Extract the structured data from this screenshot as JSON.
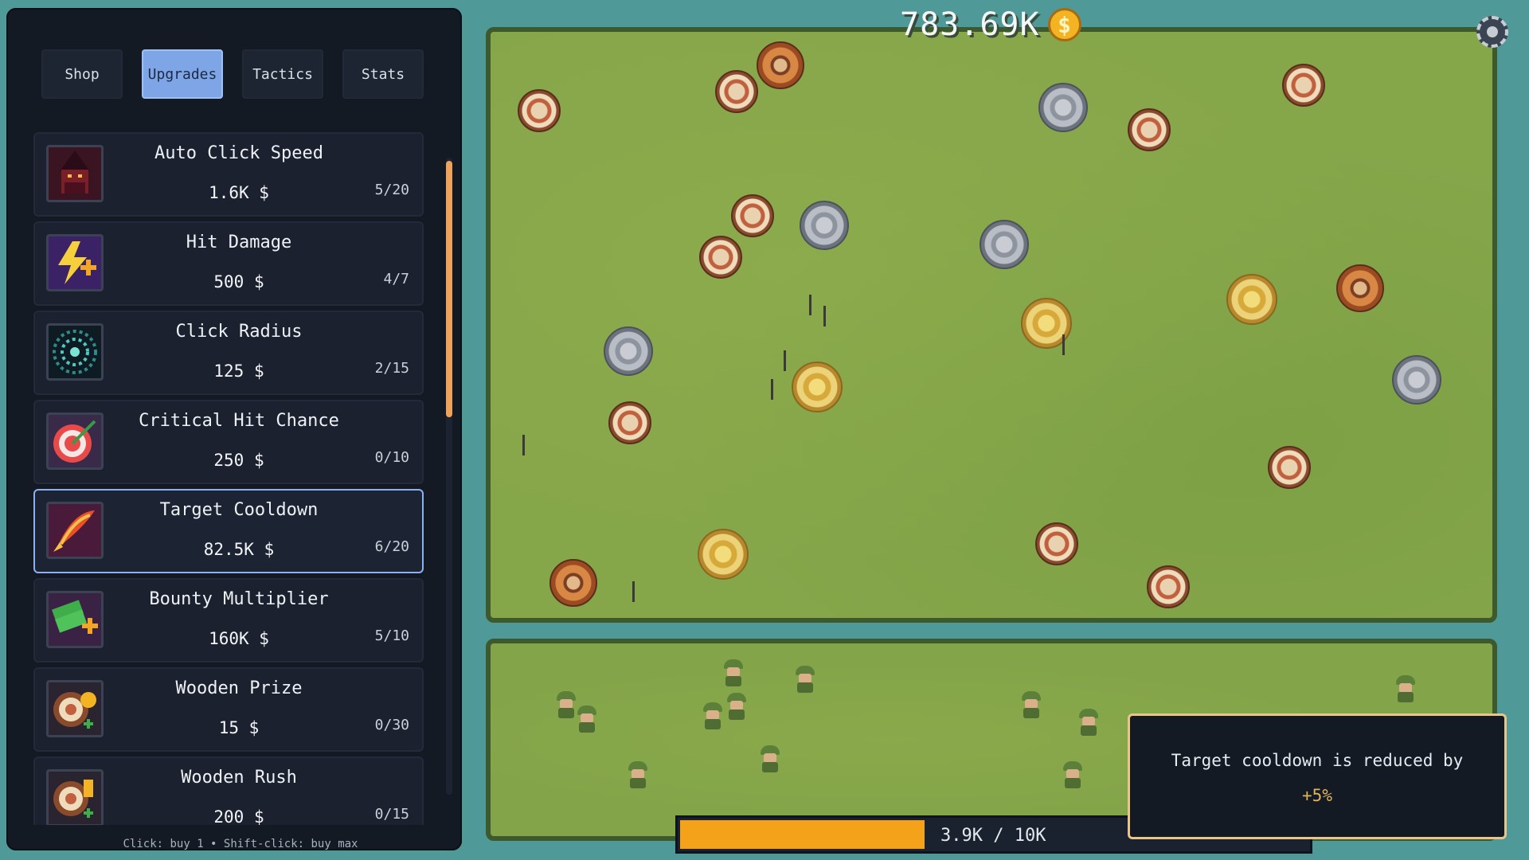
{
  "tabs": [
    {
      "label": "Shop",
      "active": false
    },
    {
      "label": "Upgrades",
      "active": true
    },
    {
      "label": "Tactics",
      "active": false
    },
    {
      "label": "Stats",
      "active": false
    }
  ],
  "upgrades": [
    {
      "name": "Auto Click Speed",
      "price": "1.6K $",
      "level": "5/20",
      "icon": "dark-wizard-icon"
    },
    {
      "name": "Hit Damage",
      "price": "500 $",
      "level": "4/7",
      "icon": "lightning-plus-icon"
    },
    {
      "name": "Click Radius",
      "price": "125 $",
      "level": "2/15",
      "icon": "radius-grid-icon"
    },
    {
      "name": "Critical Hit Chance",
      "price": "250 $",
      "level": "0/10",
      "icon": "bullseye-arrow-icon"
    },
    {
      "name": "Target Cooldown",
      "price": "82.5K $",
      "level": "6/20",
      "icon": "flaming-arrow-icon"
    },
    {
      "name": "Bounty Multiplier",
      "price": "160K $",
      "level": "5/10",
      "icon": "cash-plus-icon"
    },
    {
      "name": "Wooden Prize",
      "price": "15 $",
      "level": "0/30",
      "icon": "wooden-target-coin-icon"
    },
    {
      "name": "Wooden Rush",
      "price": "200 $",
      "level": "0/15",
      "icon": "wooden-target-rush-icon"
    }
  ],
  "footer_hint": "Click: buy 1 • Shift-click: buy max",
  "money": {
    "amount": "783.69K",
    "currency_icon": "dollar-coin-icon"
  },
  "progress": {
    "label": "3.9K / 10K",
    "fraction": 0.39
  },
  "tooltip": {
    "text": "Target cooldown is reduced by",
    "value": "+5%"
  },
  "colors": {
    "accent": "#7ea5e6",
    "progress": "#f5a21b",
    "tooltip_border": "#e8c58a",
    "panel": "#141a24",
    "grass": "#86a64a"
  }
}
